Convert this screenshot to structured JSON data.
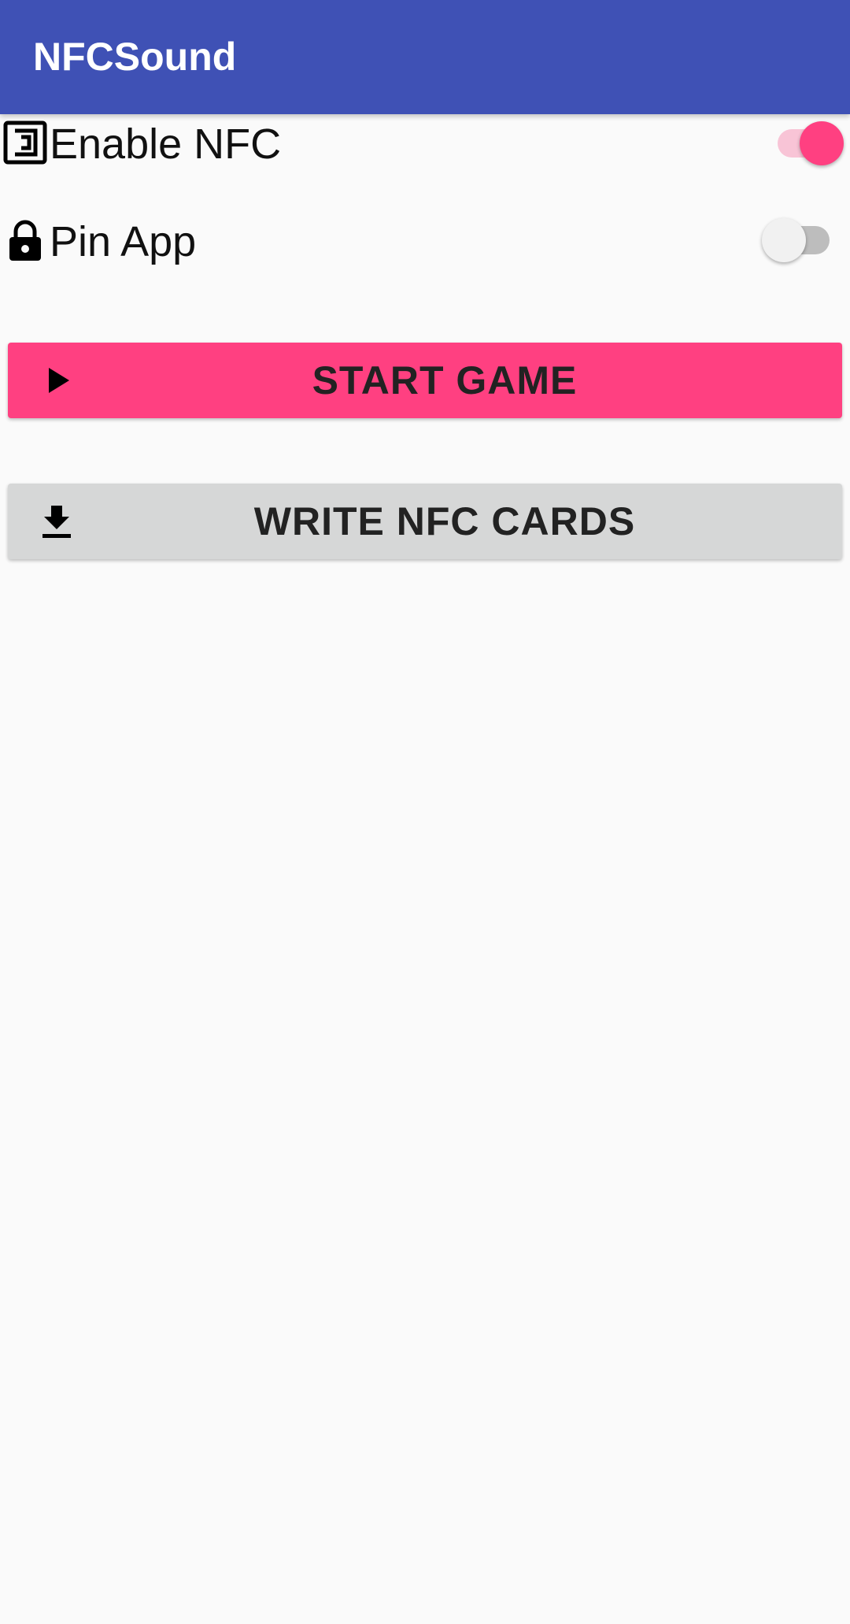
{
  "app_bar": {
    "title": "NFCSound",
    "background_color": "#3f51b5"
  },
  "settings": [
    {
      "icon": "nfc-icon",
      "label": "Enable NFC",
      "enabled": true
    },
    {
      "icon": "lock-icon",
      "label": "Pin App",
      "enabled": false
    }
  ],
  "buttons": {
    "start_game": {
      "icon": "play-icon",
      "label": "START GAME",
      "color": "#ff4081"
    },
    "write_nfc_cards": {
      "icon": "download-icon",
      "label": "WRITE NFC CARDS",
      "color": "#d6d7d7"
    }
  },
  "colors": {
    "accent": "#ff4081",
    "primary": "#3f51b5",
    "background": "#fafafa"
  }
}
